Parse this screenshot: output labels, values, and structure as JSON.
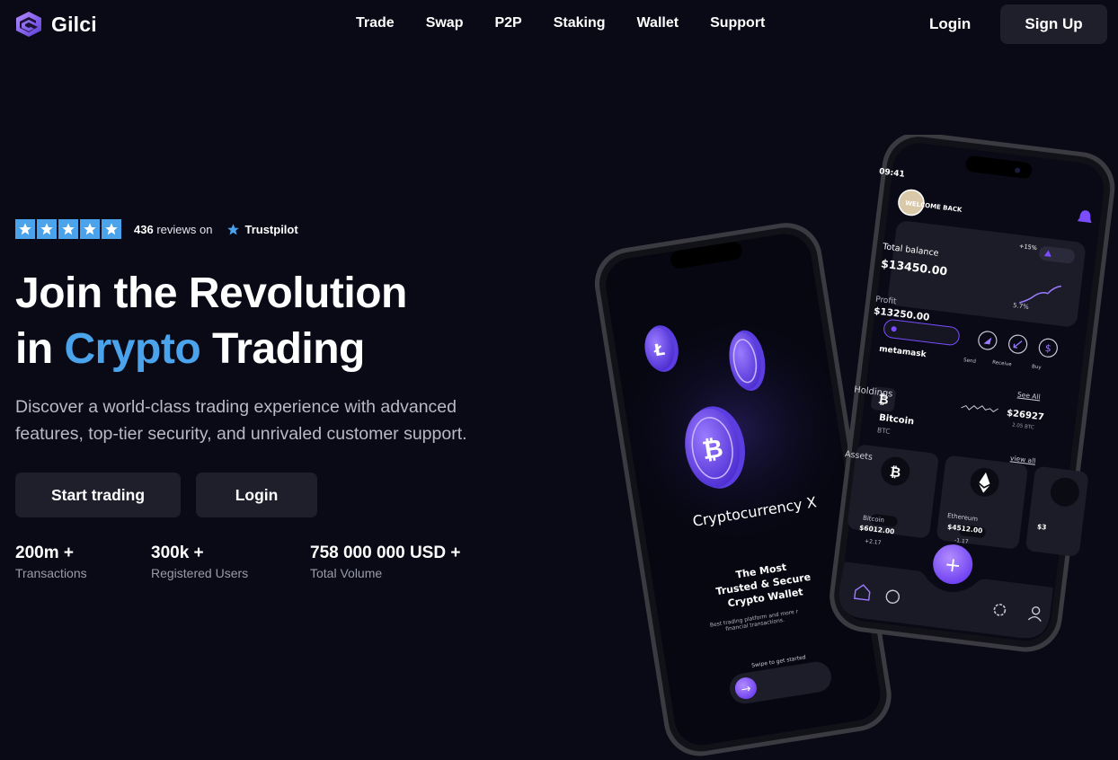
{
  "brand": {
    "name": "Gilci"
  },
  "nav": {
    "links": [
      "Trade",
      "Swap",
      "P2P",
      "Staking",
      "Wallet",
      "Support"
    ],
    "login": "Login",
    "signup": "Sign Up"
  },
  "hero": {
    "rating": {
      "stars": 5,
      "reviews_count": "436",
      "reviews_text": "reviews on",
      "platform": "Trustpilot"
    },
    "headline_line1": "Join the Revolution",
    "headline_in": "in",
    "headline_accent": "Crypto",
    "headline_end": "Trading",
    "subtitle": "Discover a world-class trading experience with advanced features, top-tier security, and unrivaled customer support.",
    "buttons": {
      "start": "Start trading",
      "login": "Login"
    },
    "stats": [
      {
        "value": "200m +",
        "label": "Transactions"
      },
      {
        "value": "300k +",
        "label": "Registered Users"
      },
      {
        "value": "758 000 000 USD +",
        "label": "Total Volume"
      }
    ]
  },
  "phone_left": {
    "title": "Cryptocurrency X",
    "tagline": [
      "The Most",
      "Trusted & Secure",
      "Crypto Wallet"
    ],
    "small": [
      "Best trading platform and more r",
      "financial transactions."
    ],
    "swipe": "Swipe to get started"
  },
  "phone_right": {
    "time": "09:41",
    "welcome": "WELCOME BACK",
    "balance_label": "Total balance",
    "balance": "$13450.00",
    "change": "+15%",
    "profit_label": "Profit",
    "profit": "$13250.00",
    "profit_pct": "5.7%",
    "wallet": "metamask",
    "actions": [
      "Send",
      "Receive",
      "Buy"
    ],
    "holdings_label": "Holdings",
    "see_all": "See All",
    "holding": {
      "name": "Bitcoin",
      "ticker": "BTC",
      "value": "$26927",
      "amount": "2.05 BTC"
    },
    "assets_label": "Assets",
    "view_all": "view all",
    "assets": [
      {
        "name": "Bitcoin",
        "price": "$6012.00",
        "change": "+2.17"
      },
      {
        "name": "Ethereum",
        "price": "$4512.00",
        "change": "-1.17"
      },
      {
        "name": "",
        "price": "$3",
        "change": ""
      }
    ]
  },
  "colors": {
    "accent": "#4ba3ec",
    "background": "#0a0a17",
    "button": "#1e1f2b",
    "purple": "#7b4dff"
  }
}
